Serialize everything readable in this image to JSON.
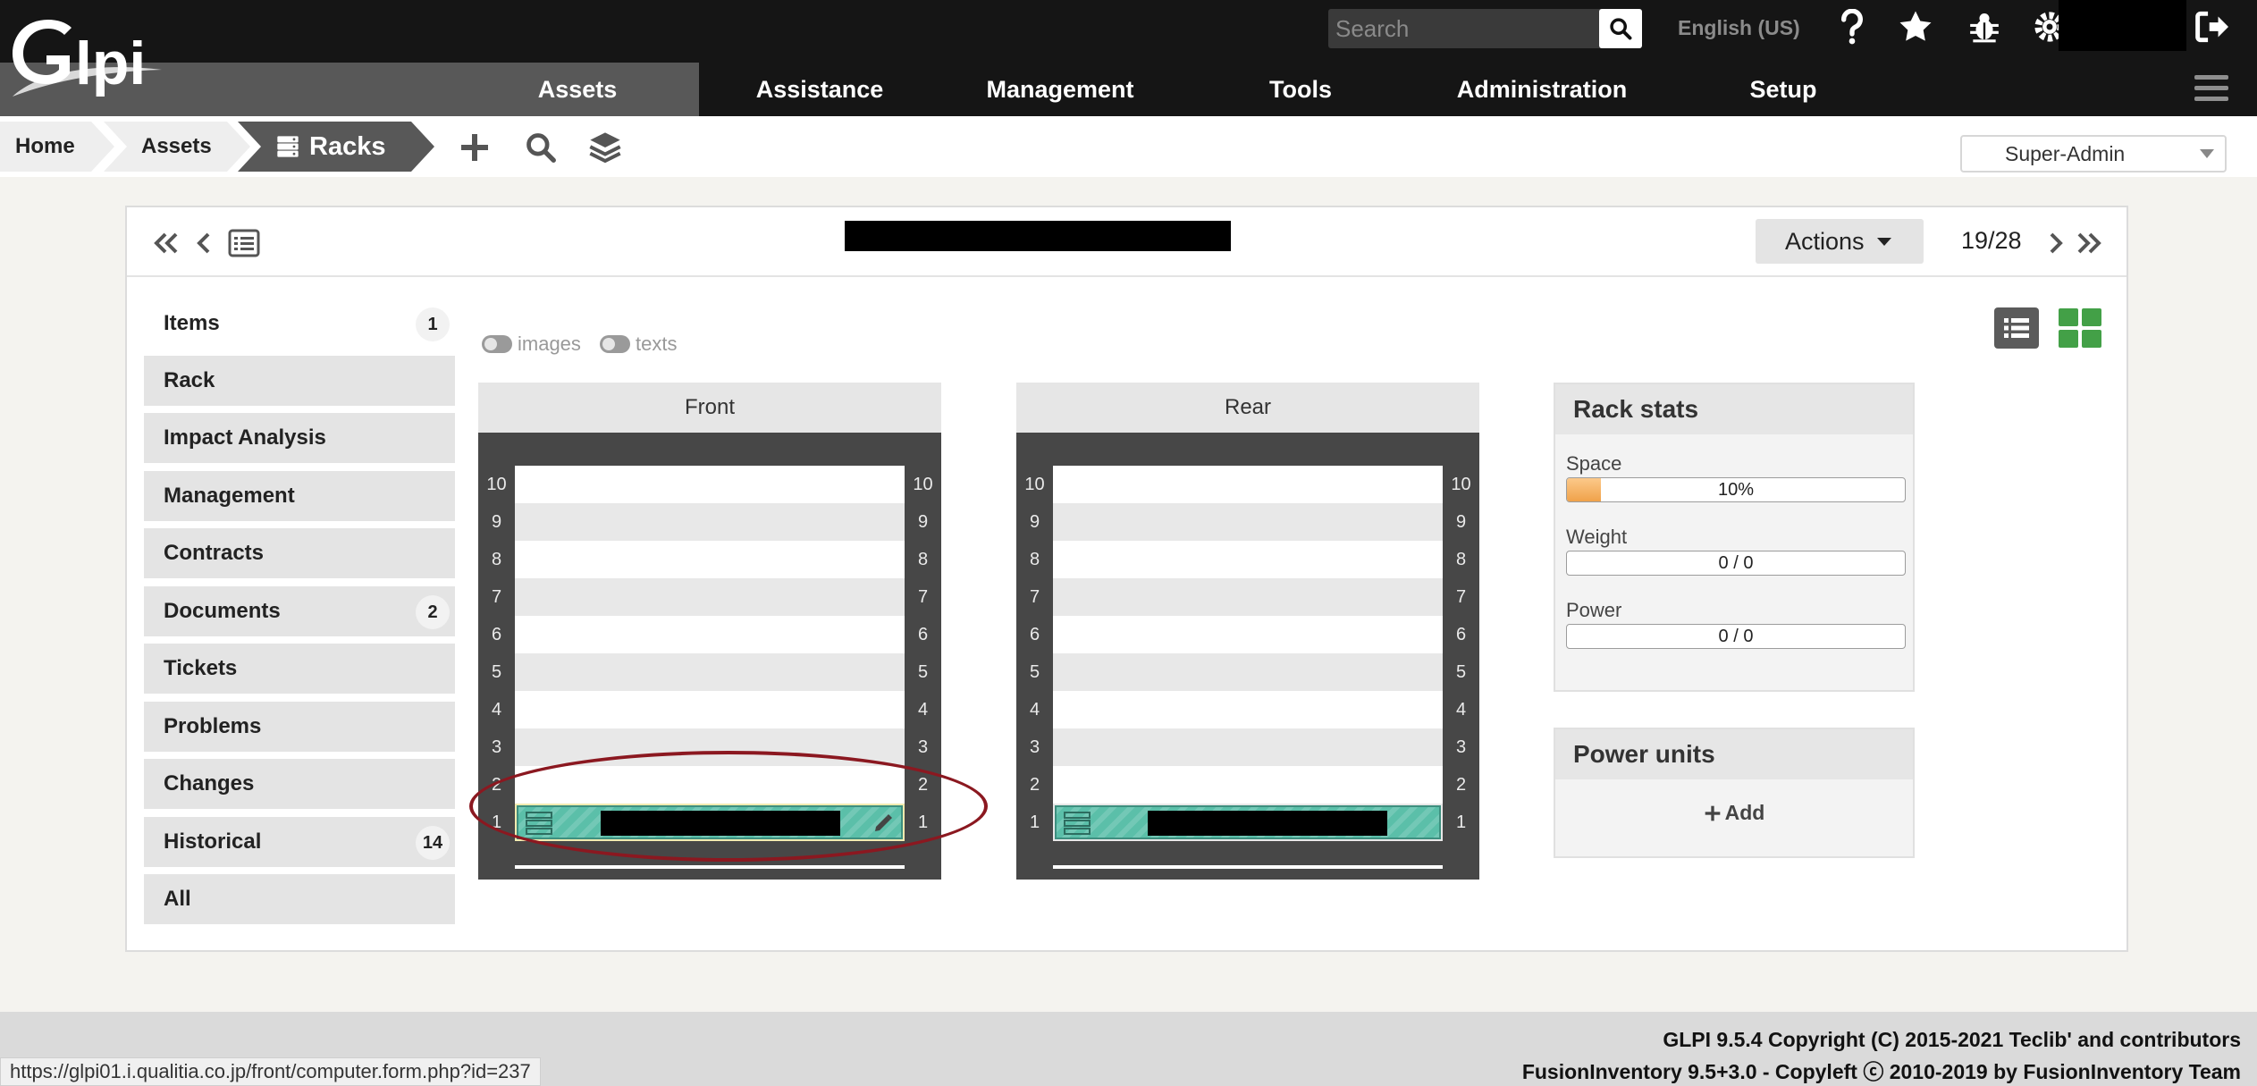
{
  "header": {
    "logo_text": "Glpi",
    "search_placeholder": "Search",
    "language": "English (US)",
    "icons": [
      "question-icon",
      "star-icon",
      "bug-icon",
      "gear-icon",
      "logout-icon"
    ]
  },
  "nav": {
    "items": [
      "Assets",
      "Assistance",
      "Management",
      "Tools",
      "Administration",
      "Setup"
    ],
    "active": "Assets"
  },
  "breadcrumb": {
    "items": [
      "Home",
      "Assets",
      "Racks"
    ]
  },
  "profile": {
    "selected": "Super-Admin"
  },
  "record": {
    "actions_label": "Actions",
    "position": "19/28"
  },
  "tabs": [
    {
      "label": "Items",
      "badge": "1"
    },
    {
      "label": "Rack",
      "badge": ""
    },
    {
      "label": "Impact Analysis",
      "badge": ""
    },
    {
      "label": "Management",
      "badge": ""
    },
    {
      "label": "Contracts",
      "badge": ""
    },
    {
      "label": "Documents",
      "badge": "2"
    },
    {
      "label": "Tickets",
      "badge": ""
    },
    {
      "label": "Problems",
      "badge": ""
    },
    {
      "label": "Changes",
      "badge": ""
    },
    {
      "label": "Historical",
      "badge": "14"
    },
    {
      "label": "All",
      "badge": ""
    }
  ],
  "toggles": {
    "images": "images",
    "texts": "texts"
  },
  "racks": {
    "front": {
      "title": "Front"
    },
    "rear": {
      "title": "Rear"
    },
    "units": [
      "10",
      "9",
      "8",
      "7",
      "6",
      "5",
      "4",
      "3",
      "2",
      "1"
    ]
  },
  "stats": {
    "title": "Rack stats",
    "space_label": "Space",
    "space_value": "10%",
    "space_fraction": 0.1,
    "weight_label": "Weight",
    "weight_value": "0 / 0",
    "power_label": "Power",
    "power_value": "0 / 0"
  },
  "power_units": {
    "title": "Power units",
    "add_label": "Add"
  },
  "footer": {
    "line1": "GLPI 9.5.4 Copyright (C) 2015-2021 Teclib' and contributors",
    "line2": "FusionInventory 9.5+3.0 - Copyleft ⓒ 2010-2019 by FusionInventory Team"
  },
  "status_url": "https://glpi01.i.qualitia.co.jp/front/computer.form.php?id=237",
  "colors": {
    "accent_green": "#43a047",
    "device": "#5bbfa9",
    "annotation": "#8b1820"
  }
}
